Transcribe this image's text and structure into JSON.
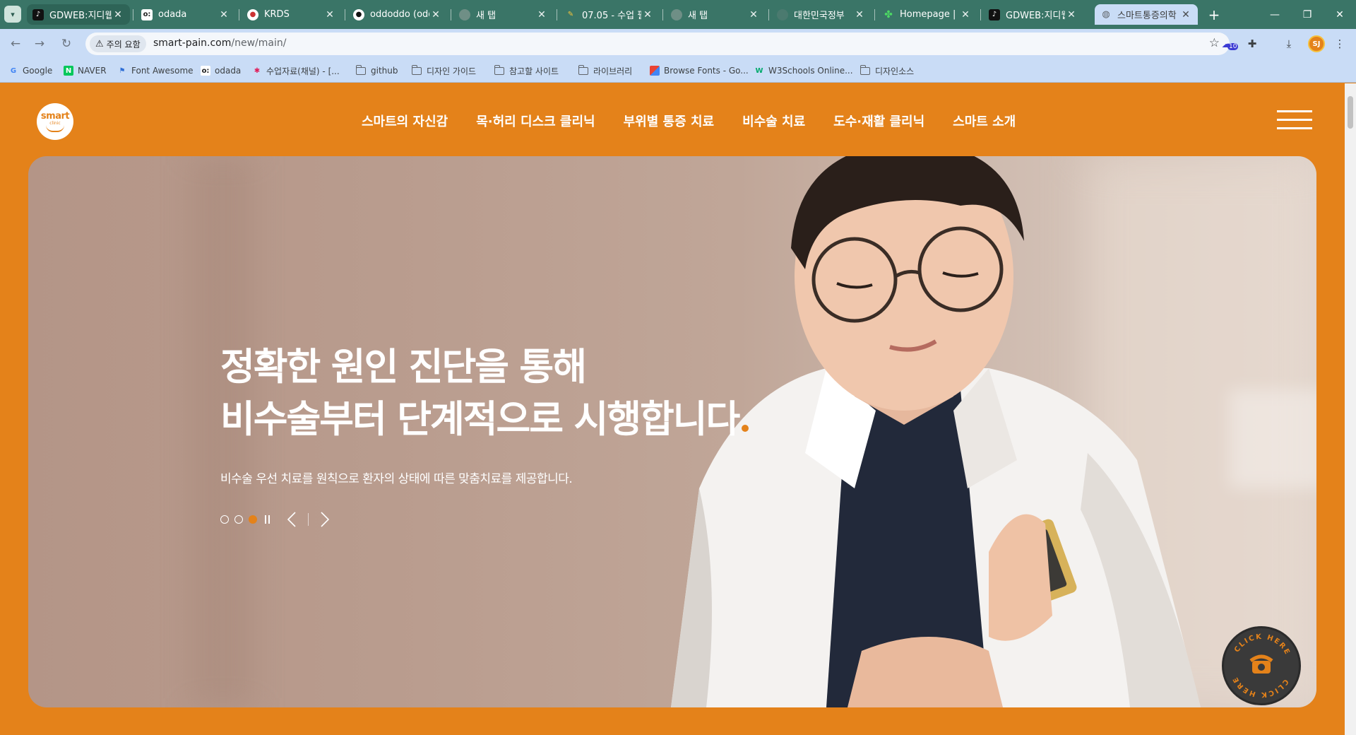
{
  "browser": {
    "tabs": [
      {
        "title": "GDWEB:지디웹",
        "favicon": "tiktok-icon"
      },
      {
        "title": "odada",
        "favicon": "odada-icon"
      },
      {
        "title": "KRDS",
        "favicon": "krds-icon"
      },
      {
        "title": "oddoddo (odd",
        "favicon": "github-icon"
      },
      {
        "title": "새 탭",
        "favicon": "chrome-icon"
      },
      {
        "title": "07.05 - 수업 필",
        "favicon": "pencil-icon"
      },
      {
        "title": "새 탭",
        "favicon": "chrome-icon"
      },
      {
        "title": "대한민국정부",
        "favicon": "gov-icon"
      },
      {
        "title": "Homepage | G",
        "favicon": "clover-icon"
      },
      {
        "title": "GDWEB:지디웹",
        "favicon": "tiktok-icon"
      },
      {
        "title": "스마트통증의학",
        "favicon": "globe-icon"
      }
    ],
    "security_chip": "주의 요함",
    "url_host": "smart-pain.com",
    "url_path": "/new/main/",
    "extension_badge": "10",
    "profile_initials": "SJ",
    "bookmarks": [
      {
        "label": "Google",
        "icon": "google-icon"
      },
      {
        "label": "NAVER",
        "icon": "naver-icon"
      },
      {
        "label": "Font Awesome",
        "icon": "flag-icon"
      },
      {
        "label": "odada",
        "icon": "odada-icon"
      },
      {
        "label": "수업자료(채널) - [...",
        "icon": "slack-icon"
      },
      {
        "label": "github",
        "icon": "folder-icon"
      },
      {
        "label": "디자인 가이드",
        "icon": "folder-icon"
      },
      {
        "label": "참고할 사이트",
        "icon": "folder-icon"
      },
      {
        "label": "라이브러리",
        "icon": "folder-icon"
      },
      {
        "label": "Browse Fonts - Go...",
        "icon": "google-fonts-icon"
      },
      {
        "label": "W3Schools Online...",
        "icon": "w3schools-icon"
      },
      {
        "label": "디자인소스",
        "icon": "folder-icon"
      }
    ]
  },
  "site": {
    "logo_text": "smart",
    "logo_sub": "clinic",
    "nav": [
      "스마트의 자신감",
      "목·허리 디스크 클리닉",
      "부위별 통증 치료",
      "비수술 치료",
      "도수·재활 클리닉",
      "스마트 소개"
    ],
    "hero": {
      "title_line1": "정확한 원인 진단을 통해",
      "title_line2": "비수술부터 단계적으로 시행합니다",
      "subtitle": "비수술 우선 치료를 원칙으로 환자의 상태에 따른 맞춤치료를 제공합니다.",
      "slides_total": 3,
      "active_slide": 3
    },
    "floating_button_text": "CLICK HERE",
    "colors": {
      "brand_orange": "#e4821a",
      "tab_strip": "#3a7567",
      "toolbar": "#c9dcf6"
    }
  }
}
